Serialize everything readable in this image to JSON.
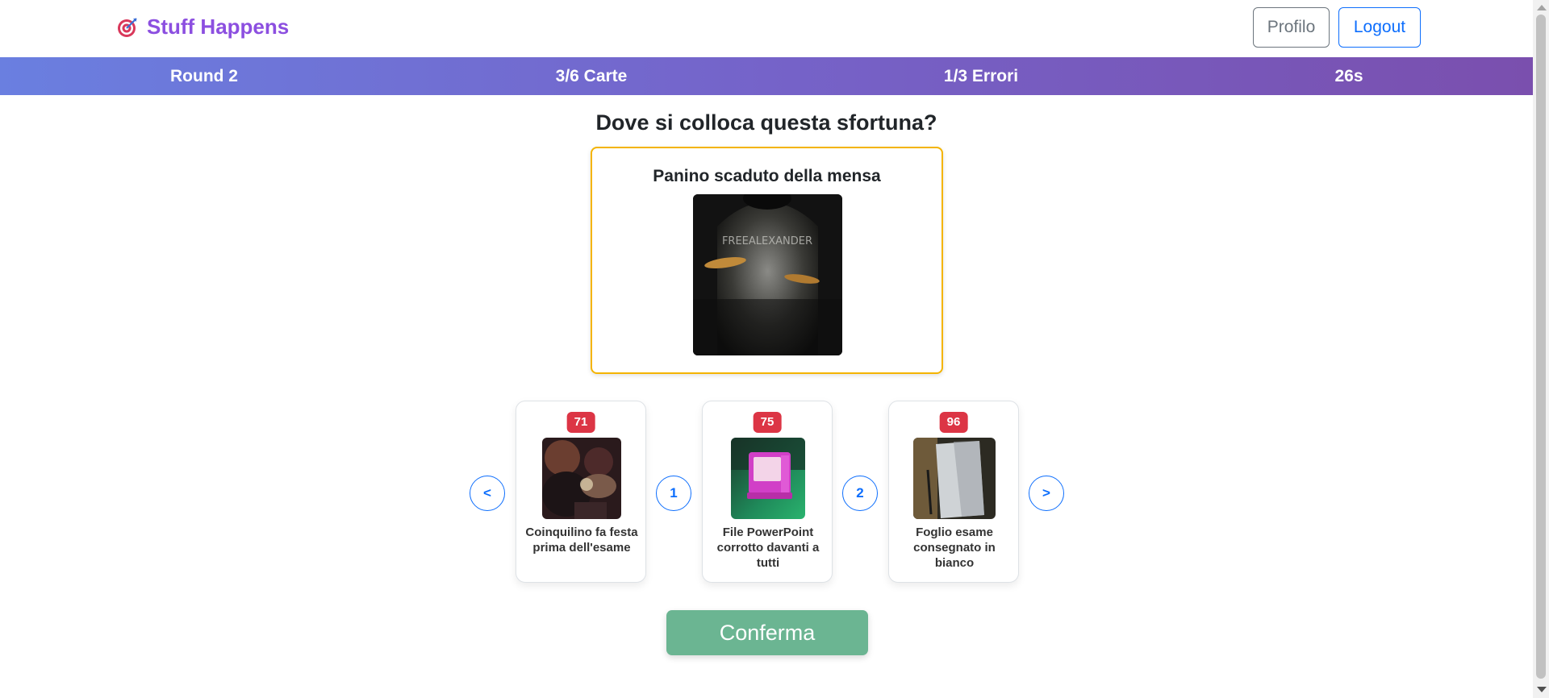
{
  "navbar": {
    "brand_icon": "target-icon",
    "brand": "Stuff Happens",
    "profile_label": "Profilo",
    "logout_label": "Logout"
  },
  "status": {
    "round": "Round 2",
    "cards": "3/6 Carte",
    "errors": "1/3 Errori",
    "timer": "26s"
  },
  "question": {
    "title": "Dove si colloca questa sfortuna?",
    "card_title": "Panino scaduto della mensa",
    "card_image_text": "FREEALEXANDER"
  },
  "hand": {
    "prev_label": "<",
    "next_label": ">",
    "positions": [
      "1",
      "2"
    ],
    "cards": [
      {
        "index": "71",
        "label": "Coinquilino fa festa prima dell'esame",
        "image": "party-photo"
      },
      {
        "index": "75",
        "label": "File PowerPoint corrotto davanti a tutti",
        "image": "retro-computer-photo"
      },
      {
        "index": "96",
        "label": "Foglio esame consegnato in bianco",
        "image": "blank-paper-photo"
      }
    ]
  },
  "confirm_label": "Conferma",
  "colors": {
    "brand": "#8c4fe0",
    "status_gradient_start": "#6a7fe0",
    "status_gradient_end": "#7a4fae",
    "badge": "#dc3545",
    "confirm": "#6bb592",
    "current_card_border": "#f4b400",
    "primary": "#0d6efd"
  }
}
